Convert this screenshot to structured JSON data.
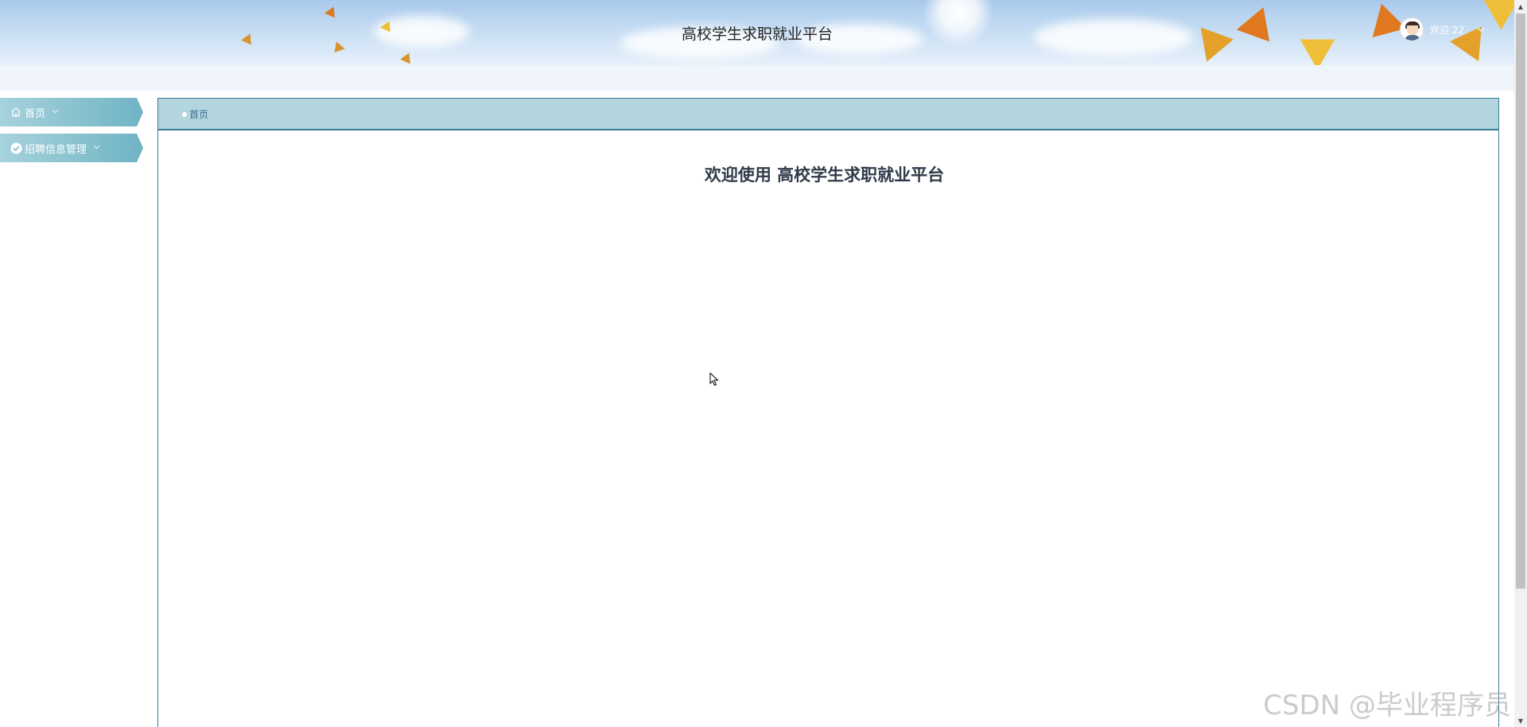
{
  "header": {
    "site_title": "高校学生求职就业平台",
    "user_greeting": "欢迎 22",
    "user_menu_icon": "chevron-down-icon"
  },
  "sidebar": {
    "items": [
      {
        "label": "首页",
        "icon": "home-icon"
      },
      {
        "label": "招聘信息管理",
        "icon": "check-circle-icon"
      }
    ]
  },
  "main": {
    "breadcrumb": "首页",
    "welcome_text": "欢迎使用 高校学生求职就业平台"
  },
  "watermark": "CSDN @毕业程序员",
  "colors": {
    "sidebar_accent": "#86c0cd",
    "breadcrumb_bg": "#b3d5dd",
    "border": "#3a7a99"
  }
}
